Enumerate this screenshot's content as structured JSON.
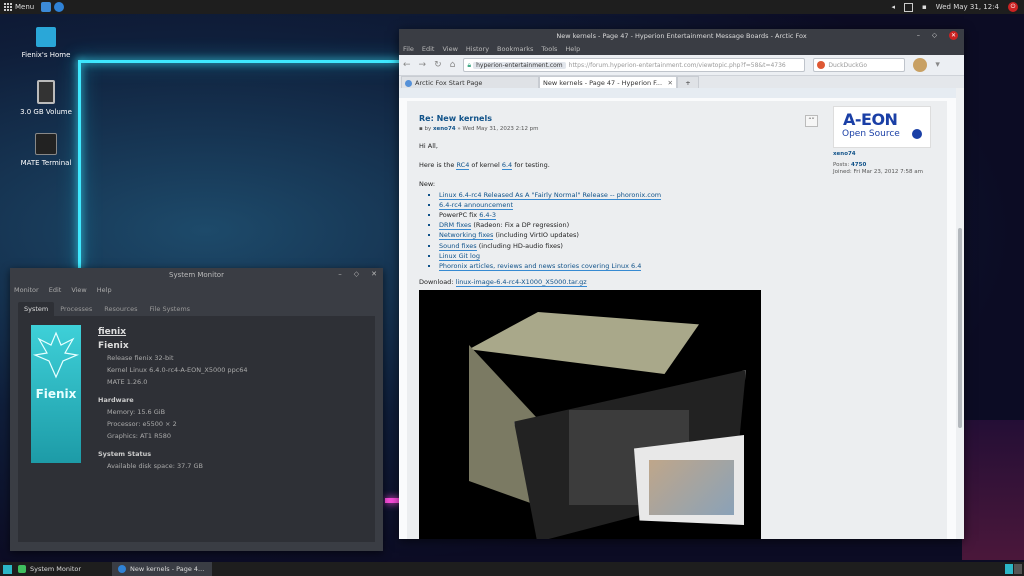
{
  "top_panel": {
    "menu_label": "Menu",
    "clock": "Wed May 31, 12:4",
    "power_glyph": "⏻"
  },
  "desktop": {
    "icons": [
      {
        "label": "Fienix's Home",
        "icon": "home-folder-icon",
        "color": "#2aa7d8"
      },
      {
        "label": "3.0 GB Volume",
        "icon": "sd-card-icon",
        "color": "#333333"
      },
      {
        "label": "MATE Terminal",
        "icon": "terminal-icon",
        "color": "#222222"
      }
    ]
  },
  "system_monitor": {
    "title": "System Monitor",
    "menu": [
      "Monitor",
      "Edit",
      "View",
      "Help"
    ],
    "tabs": [
      "System",
      "Processes",
      "Resources",
      "File Systems"
    ],
    "logo_text": "Fienix",
    "hostname": "fienix",
    "os_name": "Fienix",
    "release": "Release fienix 32-bit",
    "kernel": "Kernel Linux 6.4.0-rc4-A-EON_X5000 ppc64",
    "mate": "MATE 1.26.0",
    "hardware_heading": "Hardware",
    "memory": "Memory:     15.6 GiB",
    "processor": "Processor:  e5500 × 2",
    "graphics": "Graphics:   AT1 R580",
    "status_heading": "System Status",
    "disk": "Available disk space:  37.7 GB"
  },
  "browser": {
    "title": "New kernels - Page 47 - Hyperion Entertainment Message Boards - Arctic Fox",
    "menu": [
      "File",
      "Edit",
      "View",
      "History",
      "Bookmarks",
      "Tools",
      "Help"
    ],
    "url_domain": "hyperion-entertainment.com",
    "url_rest": "https://forum.hyperion-entertainment.com/viewtopic.php?f=58&t=4736",
    "search_placeholder": "DuckDuckGo",
    "tabs": [
      {
        "label": "Arctic Fox Start Page"
      },
      {
        "label": "New kernels - Page 47 - Hyperion F..."
      }
    ],
    "post": {
      "title": "Re: New kernels",
      "meta_prefix": "by",
      "author": "xeno74",
      "meta_date": "» Wed May 31, 2023 2:12 pm",
      "greeting": "Hi All,",
      "intro_a": "Here is the ",
      "intro_rc4": "RC4",
      "intro_b": " of kernel ",
      "intro_ver": "6.4",
      "intro_c": " for testing.",
      "new_label": "New:",
      "items": [
        {
          "link": "Linux 6.4-rc4 Released As A \"Fairly Normal\" Release -- phoronix.com",
          "text": ""
        },
        {
          "link": "6.4-rc4 announcement",
          "text": ""
        },
        {
          "prefix": "PowerPC fix ",
          "link": "6.4-3",
          "text": ""
        },
        {
          "link": "DRM fixes",
          "text": " (Radeon: Fix a DP regression)"
        },
        {
          "link": "Networking fixes",
          "text": " (including VirtIO updates)"
        },
        {
          "link": "Sound fixes",
          "text": " (including HD-audio fixes)"
        },
        {
          "link": "Linux Git log",
          "text": ""
        },
        {
          "link": "Phoronix articles, reviews and news stories covering Linux 6.4",
          "text": ""
        }
      ],
      "download_label": "Download: ",
      "download_link": "linux-image-6.4-rc4-X1000_X5000.tar.gz",
      "quote_glyph": "“”"
    },
    "sidebar": {
      "logo_big": "A-EON",
      "logo_small": "Open Source",
      "username": "xeno74",
      "posts_label": "Posts: ",
      "posts": "4750",
      "joined": "Joined: Fri Mar 23, 2012 7:58 am"
    }
  },
  "bottom_panel": {
    "tasks": [
      {
        "label": "System Monitor"
      },
      {
        "label": "New kernels - Page 4..."
      }
    ]
  }
}
